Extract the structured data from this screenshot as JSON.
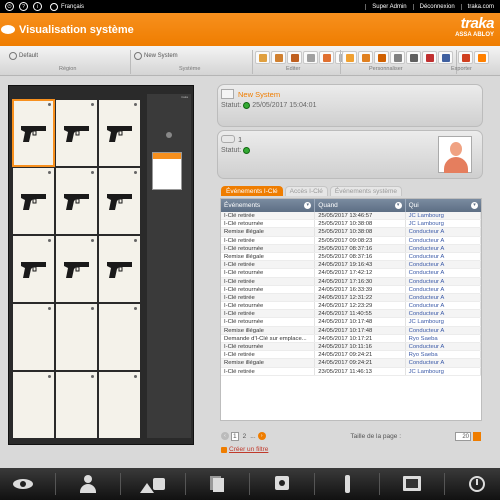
{
  "topbar": {
    "icons": [
      "power-icon",
      "help-icon",
      "info-icon"
    ],
    "icon_glyphs": [
      "⏻",
      "?",
      "i"
    ],
    "language": "Français",
    "user": "Super Admin",
    "logout": "Déconnexion",
    "site": "traka.com"
  },
  "header": {
    "title": "Visualisation système",
    "brand": "traka",
    "brand_sub": "ASSA ABLOY"
  },
  "toolbar": {
    "region_value": "Default",
    "region_label": "Région",
    "system_value": "New System",
    "system_label": "Système",
    "edit_label": "Editer",
    "custom_label": "Personnaliser",
    "export_label": "Exporter",
    "edit_icons": [
      "#e0a040",
      "#d08030",
      "#c06020",
      "#a0a0a0",
      "#e07030",
      "#b0b0b0"
    ],
    "custom_icons": [
      "#f0a030",
      "#e08020",
      "#d06000",
      "#808080",
      "#606060",
      "#c03030",
      "#4060a0"
    ],
    "export_icons": [
      "#d04020",
      "#ff8000"
    ]
  },
  "cabinet": {
    "tag": "traka",
    "slots": [
      true,
      true,
      true,
      true,
      true,
      true,
      true,
      true,
      true,
      false,
      false,
      false,
      false,
      false,
      false
    ],
    "selected_slot": 0
  },
  "system_panel": {
    "name": "New System",
    "status_label": "Statut:",
    "status_time": "25/05/2017 15:04:01"
  },
  "user_panel": {
    "name": "1",
    "status_label": "Statut:"
  },
  "tabs": [
    {
      "label": "Événements I-Clé",
      "active": true
    },
    {
      "label": "Accès I-Clé",
      "active": false
    },
    {
      "label": "Événements système",
      "active": false
    }
  ],
  "table": {
    "columns": [
      "Événements",
      "Quand",
      "Qui"
    ],
    "rows": [
      [
        "I-Clé retirée",
        "25/05/2017 13:46:57",
        "JC Lambourg"
      ],
      [
        "I-Clé retournée",
        "25/05/2017 10:38:08",
        "JC Lambourg"
      ],
      [
        "Remise illégale",
        "25/05/2017 10:38:08",
        "Conducteur A"
      ],
      [
        "I-Clé retirée",
        "25/05/2017 09:08:23",
        "Conducteur A"
      ],
      [
        "I-Clé retournée",
        "25/05/2017 08:37:16",
        "Conducteur A"
      ],
      [
        "Remise illégale",
        "25/05/2017 08:37:16",
        "Conducteur A"
      ],
      [
        "I-Clé retirée",
        "24/05/2017 19:16:43",
        "Conducteur A"
      ],
      [
        "I-Clé retournée",
        "24/05/2017 17:42:12",
        "Conducteur A"
      ],
      [
        "I-Clé retirée",
        "24/05/2017 17:16:30",
        "Conducteur A"
      ],
      [
        "I-Clé retournée",
        "24/05/2017 16:33:39",
        "Conducteur A"
      ],
      [
        "I-Clé retirée",
        "24/05/2017 12:31:22",
        "Conducteur A"
      ],
      [
        "I-Clé retournée",
        "24/05/2017 12:23:29",
        "Conducteur A"
      ],
      [
        "I-Clé retirée",
        "24/05/2017 11:40:55",
        "Conducteur A"
      ],
      [
        "I-Clé retournée",
        "24/05/2017 10:17:48",
        "JC Lambourg"
      ],
      [
        "Remise illégale",
        "24/05/2017 10:17:48",
        "Conducteur A"
      ],
      [
        "Demande d'I-Clé sur emplace...",
        "24/05/2017 10:17:21",
        "Ryo Saeba"
      ],
      [
        "I-Clé retournée",
        "24/05/2017 10:11:16",
        "Conducteur A"
      ],
      [
        "I-Clé retirée",
        "24/05/2017 09:24:21",
        "Ryo Saeba"
      ],
      [
        "Remise illégale",
        "24/05/2017 09:24:21",
        "Conducteur A"
      ],
      [
        "I-Clé retirée",
        "23/05/2017 11:46:13",
        "JC Lambourg"
      ]
    ]
  },
  "pager": {
    "prev": "‹",
    "pages": [
      "1",
      "2"
    ],
    "current": "1",
    "ellipsis": "...",
    "next": "›",
    "page_size_label": "Taille de la page :",
    "page_size": "20",
    "filter_label": "Créer un filtre"
  },
  "bottombar": {
    "icons": [
      "eye-icon",
      "user-icon",
      "shapes-icon",
      "documents-icon",
      "settings-icon",
      "key-icon",
      "display-icon",
      "history-icon"
    ]
  }
}
